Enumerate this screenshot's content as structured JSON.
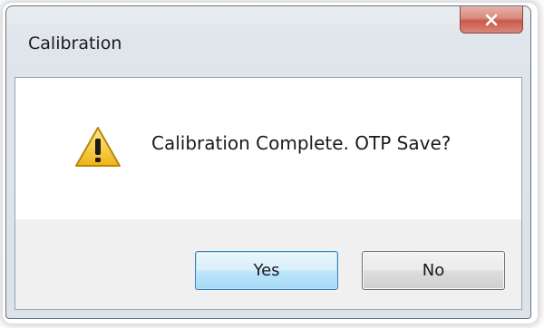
{
  "dialog": {
    "title": "Calibration",
    "message": "Calibration Complete. OTP Save?",
    "icon": "warning-icon",
    "buttons": {
      "yes_label": "Yes",
      "no_label": "No"
    },
    "close_icon": "close-icon"
  },
  "colors": {
    "frame": "#dbe2e9",
    "content_background": "#ffffff",
    "button_area": "#f0f0f0",
    "close_button": "#c9594a",
    "default_button_border": "#3c7fb1",
    "warning_yellow": "#f4c430"
  }
}
